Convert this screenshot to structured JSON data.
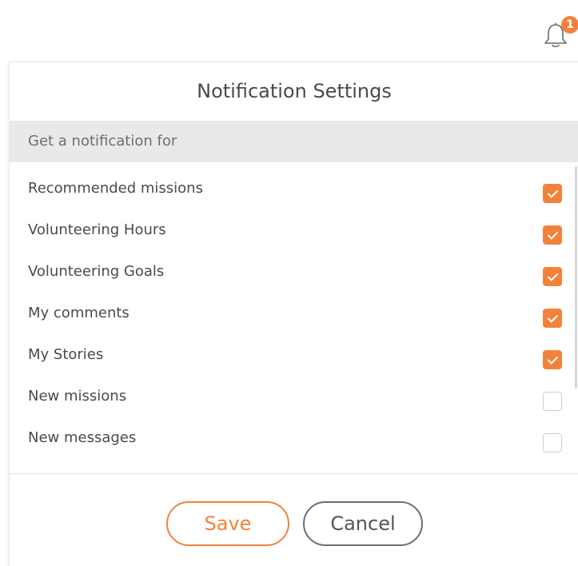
{
  "header": {
    "bell_icon": "bell-icon",
    "notification_count": "1"
  },
  "panel": {
    "title": "Notification Settings",
    "section_label": "Get a notification for",
    "items": [
      {
        "label": "Recommended missions",
        "checked": true
      },
      {
        "label": "Volunteering Hours",
        "checked": true
      },
      {
        "label": "Volunteering Goals",
        "checked": true
      },
      {
        "label": "My comments",
        "checked": true
      },
      {
        "label": "My Stories",
        "checked": true
      },
      {
        "label": "New missions",
        "checked": false
      },
      {
        "label": "New messages",
        "checked": false
      }
    ]
  },
  "footer": {
    "save_label": "Save",
    "cancel_label": "Cancel"
  },
  "colors": {
    "accent": "#f2823a",
    "header_bg": "#e9e9e9",
    "text": "#4a4a4a"
  }
}
